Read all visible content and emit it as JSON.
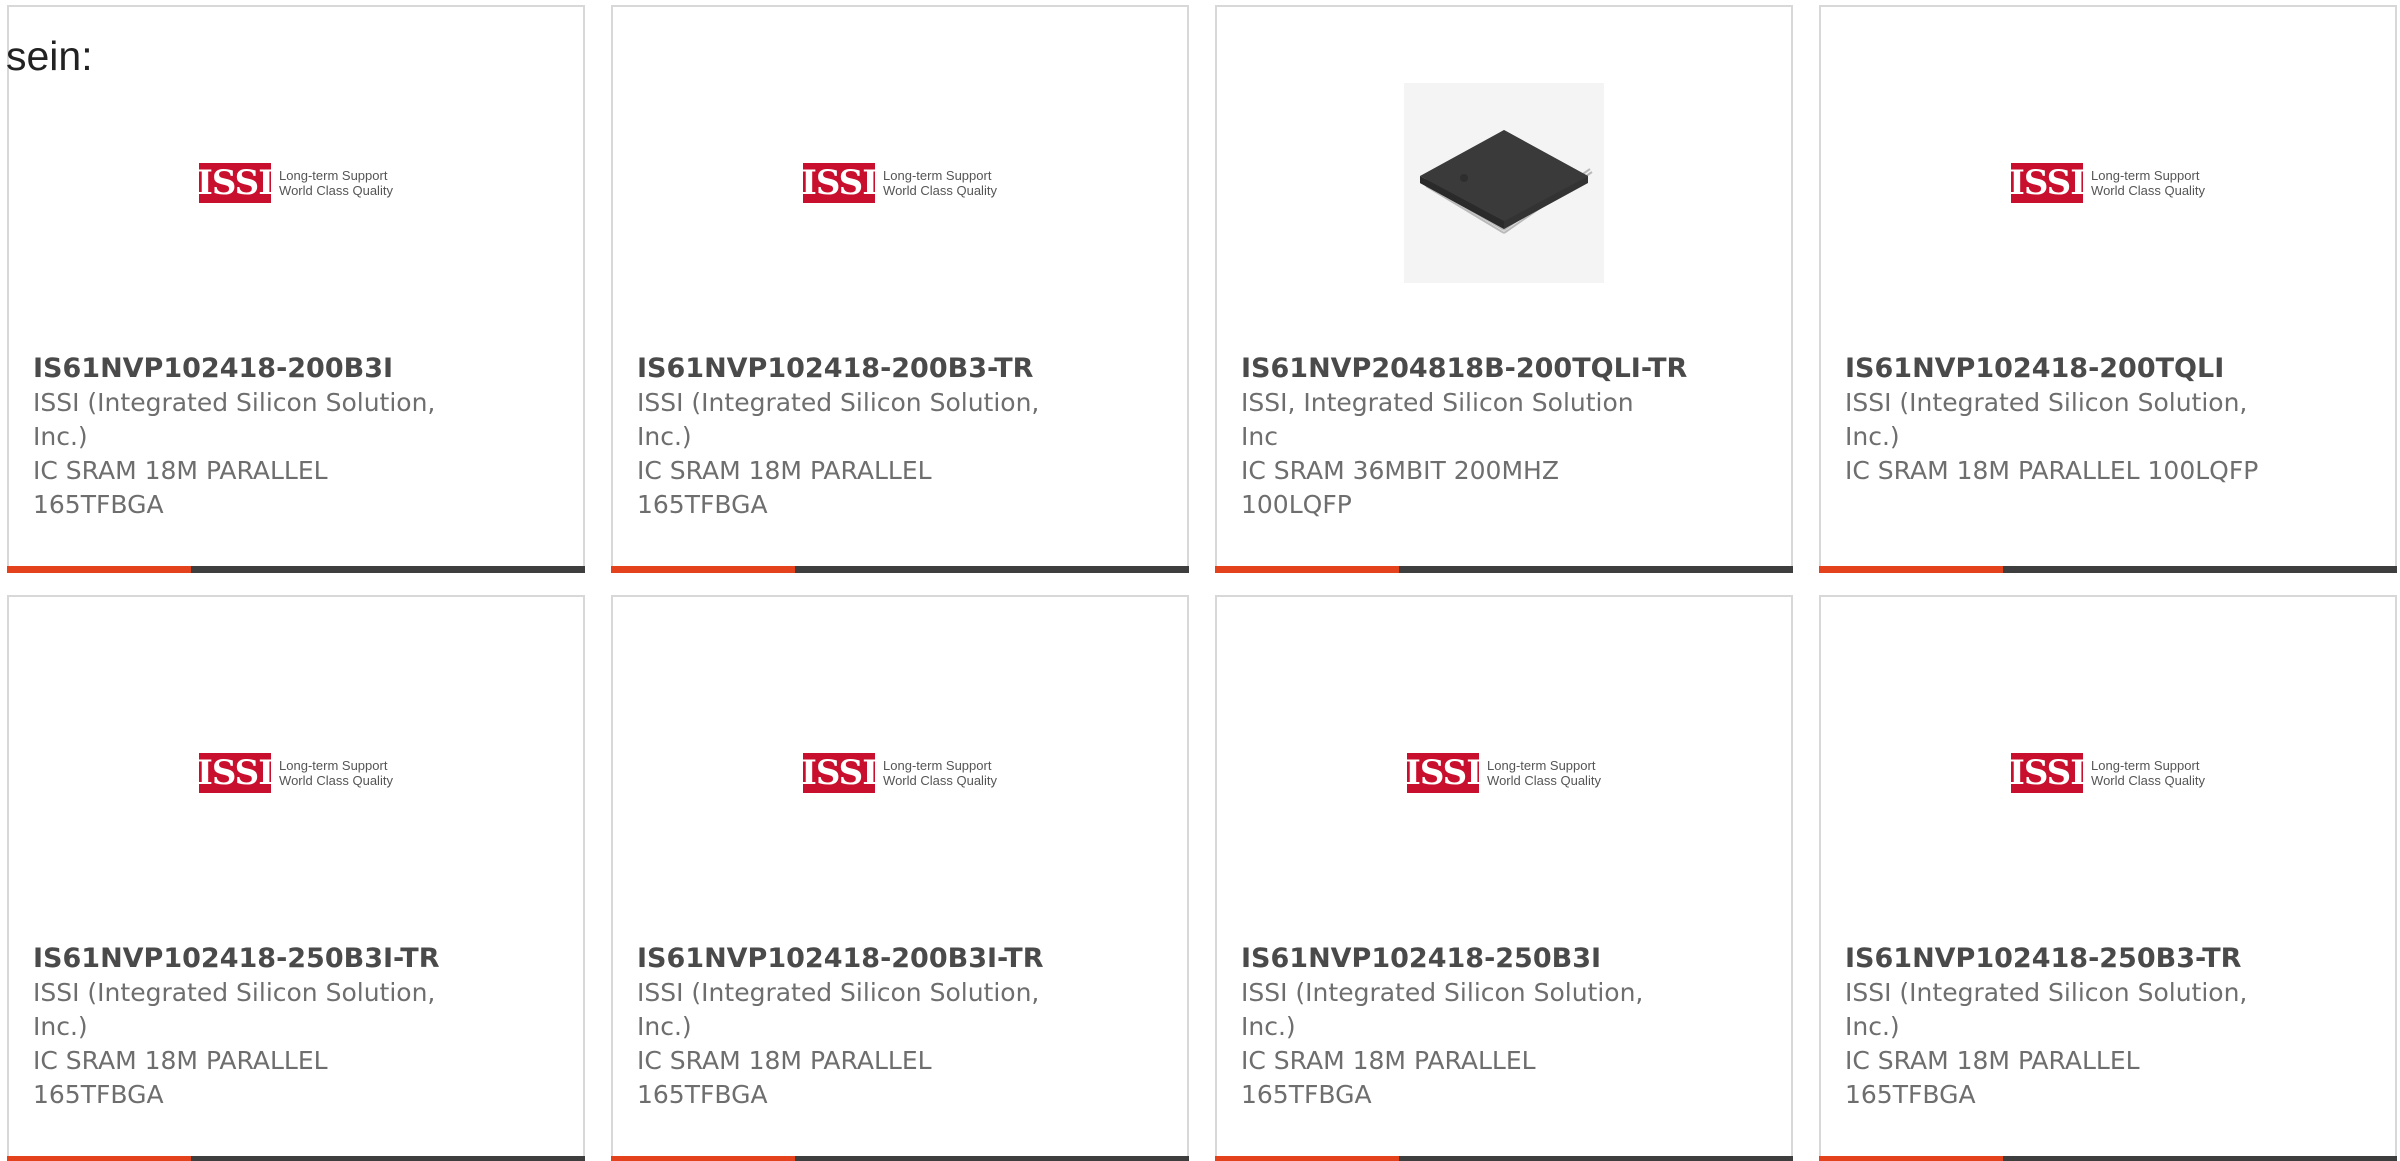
{
  "intro_text": "sein:",
  "issi_logo": {
    "mark": "ISSI",
    "tagline_1": "Long-term Support",
    "tagline_2": "World Class Quality"
  },
  "products": [
    {
      "part_number": "IS61NVP102418-200B3I",
      "manufacturer_line1": "ISSI (Integrated Silicon Solution,",
      "manufacturer_line2": "Inc.)",
      "description_line1": "IC SRAM 18M PARALLEL",
      "description_line2": "165TFBGA",
      "image": "issi-logo"
    },
    {
      "part_number": "IS61NVP102418-200B3-TR",
      "manufacturer_line1": "ISSI (Integrated Silicon Solution,",
      "manufacturer_line2": "Inc.)",
      "description_line1": "IC SRAM 18M PARALLEL",
      "description_line2": "165TFBGA",
      "image": "issi-logo"
    },
    {
      "part_number": "IS61NVP204818B-200TQLI-TR",
      "manufacturer_line1": "ISSI, Integrated Silicon Solution",
      "manufacturer_line2": "Inc",
      "description_line1": "IC SRAM 36MBIT 200MHZ",
      "description_line2": "100LQFP",
      "image": "lqfp-chip-photo"
    },
    {
      "part_number": "IS61NVP102418-200TQLI",
      "manufacturer_line1": "ISSI (Integrated Silicon Solution,",
      "manufacturer_line2": "Inc.)",
      "description_line1": "IC SRAM 18M PARALLEL 100LQFP",
      "description_line2": "",
      "image": "issi-logo"
    },
    {
      "part_number": "IS61NVP102418-250B3I-TR",
      "manufacturer_line1": "ISSI (Integrated Silicon Solution,",
      "manufacturer_line2": "Inc.)",
      "description_line1": "IC SRAM 18M PARALLEL",
      "description_line2": "165TFBGA",
      "image": "issi-logo"
    },
    {
      "part_number": "IS61NVP102418-200B3I-TR",
      "manufacturer_line1": "ISSI (Integrated Silicon Solution,",
      "manufacturer_line2": "Inc.)",
      "description_line1": "IC SRAM 18M PARALLEL",
      "description_line2": "165TFBGA",
      "image": "issi-logo"
    },
    {
      "part_number": "IS61NVP102418-250B3I",
      "manufacturer_line1": "ISSI (Integrated Silicon Solution,",
      "manufacturer_line2": "Inc.)",
      "description_line1": "IC SRAM 18M PARALLEL",
      "description_line2": "165TFBGA",
      "image": "issi-logo"
    },
    {
      "part_number": "IS61NVP102418-250B3-TR",
      "manufacturer_line1": "ISSI (Integrated Silicon Solution,",
      "manufacturer_line2": "Inc.)",
      "description_line1": "IC SRAM 18M PARALLEL",
      "description_line2": "165TFBGA",
      "image": "issi-logo"
    }
  ],
  "colors": {
    "accent": "#e3421c",
    "bar_dark": "#3e3e3e",
    "issi_red": "#c8102e",
    "part_number_text": "#4a4a4a",
    "detail_text": "#6e6e6e",
    "card_border": "#d8d8d8"
  }
}
